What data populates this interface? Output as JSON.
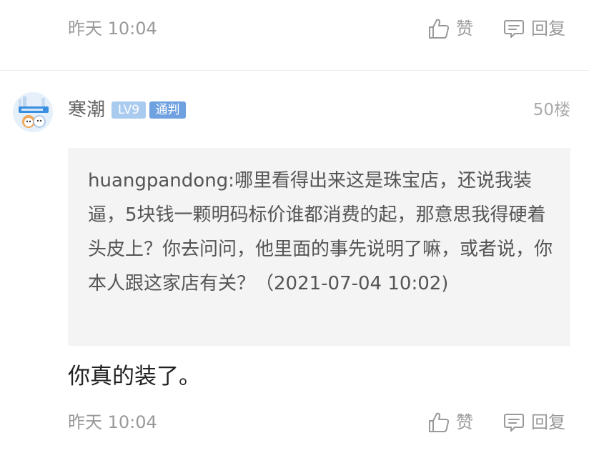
{
  "previous_comment": {
    "time": "昨天 10:04",
    "like_label": "赞",
    "reply_label": "回复"
  },
  "comment": {
    "username": "寒潮",
    "level_badge": "LV9",
    "role_badge": "通判",
    "floor": "50楼",
    "quote": "huangpandong:哪里看得出来这是珠宝店，还说我装逼，5块钱一颗明码标价谁都消费的起，那意思我得硬着头皮上？你去问问，他里面的事先说明了嘛，或者说，你本人跟这家店有关？（2021-07-04 10:02)",
    "text": "你真的装了。",
    "time": "昨天 10:04",
    "like_label": "赞",
    "reply_label": "回复"
  },
  "icons": {
    "like": "thumbs-up-icon",
    "reply": "comment-bubble-icon"
  },
  "colors": {
    "level_badge": "#a9cbef",
    "role_badge": "#6fa1e0",
    "quote_background": "#f4f4f4",
    "meta_text": "#999999"
  }
}
